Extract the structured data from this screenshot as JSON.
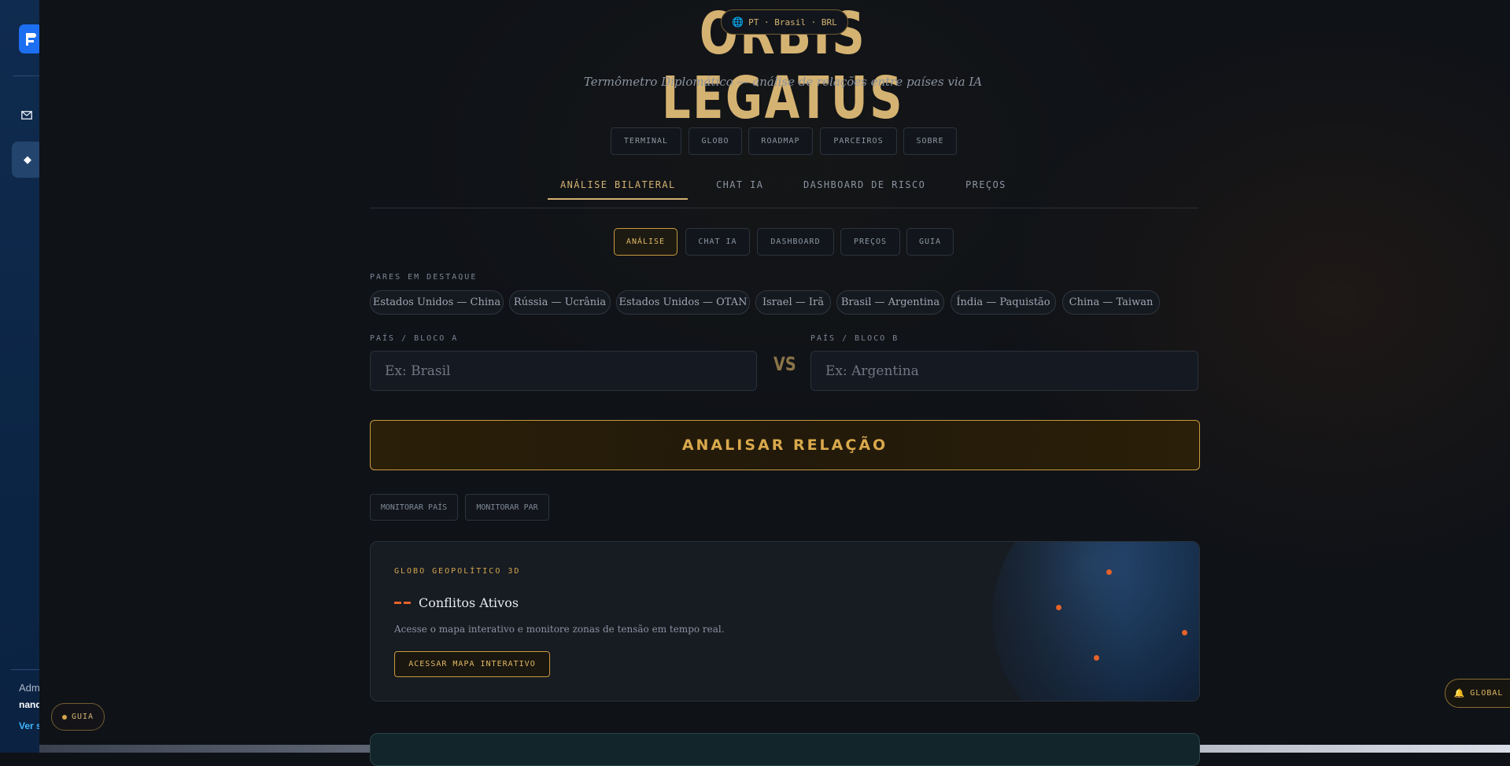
{
  "rail": {
    "admin_label": "Adm",
    "user_label": "nand",
    "link_label": "Ver s"
  },
  "brand": {
    "title": "ORBIS LEGATUS",
    "subtitle": "Termômetro Diplomático — análise de relações entre países via IA"
  },
  "locale": {
    "label": "PT · Brasil · BRL"
  },
  "top_nav": [
    "TERMINAL",
    "GLOBO",
    "ROADMAP",
    "PARCEIROS",
    "SOBRE"
  ],
  "tabs": [
    "ANÁLISE BILATERAL",
    "CHAT IA",
    "DASHBOARD DE RISCO",
    "PREÇOS"
  ],
  "sub_tabs": [
    "ANÁLISE",
    "CHAT IA",
    "DASHBOARD",
    "PREÇOS",
    "GUIA"
  ],
  "featured": {
    "label": "PARES EM DESTAQUE",
    "pairs": [
      "Estados Unidos — China",
      "Rússia — Ucrânia",
      "Estados Unidos — OTAN",
      "Israel — Irã",
      "Brasil — Argentina",
      "Índia — Paquistão",
      "China — Taiwan"
    ]
  },
  "form": {
    "country_a_label": "PAÍS / BLOCO A",
    "country_a_placeholder": "Ex: Brasil",
    "vs": "VS",
    "country_b_label": "PAÍS / BLOCO B",
    "country_b_placeholder": "Ex: Argentina",
    "analyze_label": "ANALISAR RELAÇÃO",
    "monitor_country": "MONITORAR PAÍS",
    "monitor_pair": "MONITORAR PAR"
  },
  "globe_card": {
    "kicker": "GLOBO GEOPOLÍTICO 3D",
    "title": "Conflitos Ativos",
    "description": "Acesse o mapa interativo e monitore zonas de tensão em tempo real.",
    "cta": "ACESSAR MAPA INTERATIVO"
  },
  "floating": {
    "guia": "GUIA",
    "global": "GLOBAL"
  },
  "colors": {
    "accent_gold": "#d4b272",
    "alert_orange": "#e5622a",
    "background": "#0f1217"
  }
}
